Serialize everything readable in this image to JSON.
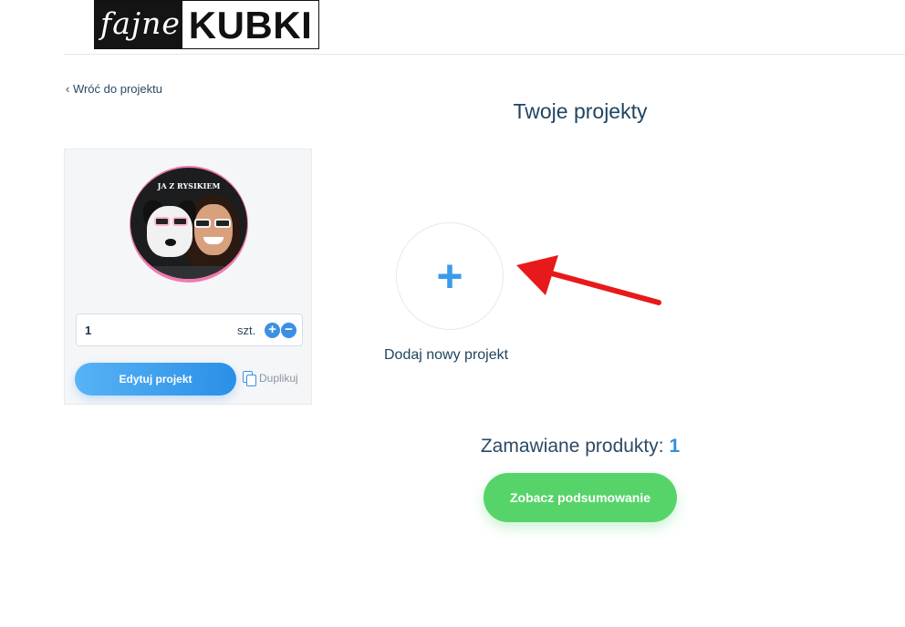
{
  "logo": {
    "left_text": "fajne",
    "right_text": "KUBKI"
  },
  "nav": {
    "back_link": "‹ Wróć do projektu"
  },
  "page": {
    "title": "Twoje projekty"
  },
  "project_card": {
    "mug_caption": "JA Z RYSIKIEM",
    "quantity": "1",
    "unit": "szt.",
    "plus_icon": "+",
    "minus_icon": "−",
    "edit_button": "Edytuj projekt",
    "duplicate_link": "Duplikuj"
  },
  "new_project": {
    "plus_icon": "+",
    "label": "Dodaj nowy projekt"
  },
  "summary": {
    "ordered_label": "Zamawiane produkty:",
    "ordered_count": "1",
    "button": "Zobacz podsumowanie"
  },
  "colors": {
    "accent_blue": "#2f8fe0",
    "green_button": "#56d46a",
    "arrow_red": "#e8191a"
  }
}
